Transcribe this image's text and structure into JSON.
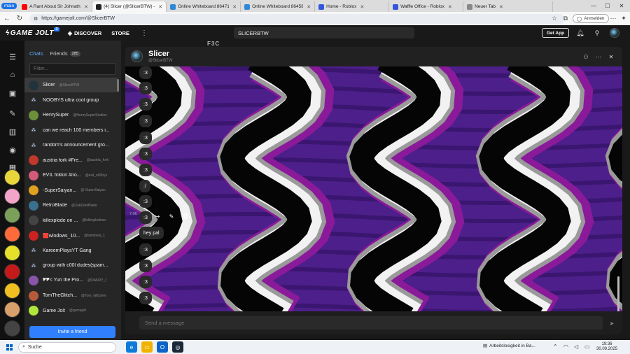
{
  "browser": {
    "tab_group": "main",
    "tabs": [
      {
        "title": "A Rant About Sir Johnatha",
        "color": "#ff0000"
      },
      {
        "title": "(4) Slicer (@SlicerBTW) - Game",
        "color": "#222222",
        "active": true
      },
      {
        "title": "Online Whiteboard 8647151",
        "color": "#2f88d6"
      },
      {
        "title": "Online Whiteboard 8645834",
        "color": "#2f88d6"
      },
      {
        "title": "Home - Roblox",
        "color": "#3355dd"
      },
      {
        "title": "Waffle Office - Roblox",
        "color": "#3355dd"
      },
      {
        "title": "Neuer Tab",
        "color": "#888888"
      }
    ],
    "url": "https://gamejolt.com/@SlicerBTW",
    "signin_label": "Anmelden"
  },
  "gj_nav": {
    "logo": "GAME JOLT",
    "logo_badge": "3",
    "discover": "DISCOVER",
    "store": "STORE",
    "search_value": "SLICERBTW",
    "get_app": "Get App"
  },
  "background_peek": "F3C",
  "sidebar": {
    "tab_chats": "Chats",
    "tab_friends": "Friends",
    "friends_count": "285",
    "filter_placeholder": "Filter...",
    "invite_label": "Invite a friend",
    "chats": [
      {
        "name": "Slicer",
        "user": "@SlicerBTW",
        "type": "user",
        "color": "#21333d",
        "selected": true
      },
      {
        "name": "NOOBYS ultra cool group",
        "user": "",
        "type": "group"
      },
      {
        "name": "HenrySuper",
        "user": "@HenrySuperStudios",
        "type": "user",
        "color": "#6b8f3a"
      },
      {
        "name": "can we reach 100 members i...",
        "user": "",
        "type": "group"
      },
      {
        "name": "random's announcement gro...",
        "user": "",
        "type": "group"
      },
      {
        "name": "austria fork #Fre...",
        "user": "@austria_fork",
        "type": "user",
        "color": "#c0392b"
      },
      {
        "name": "EVIL frikkin #no...",
        "user": "@evil_n00bys",
        "type": "user",
        "color": "#d35b7a"
      },
      {
        "name": "-SuperSaiyan...",
        "user": "@-SuperSaiyan",
        "type": "user",
        "color": "#e0a020"
      },
      {
        "name": "RetroBlade",
        "user": "@ZakDarkBlade",
        "type": "user",
        "color": "#3a6f8f"
      },
      {
        "name": "killexplode on ...",
        "user": "@killexplodeon",
        "type": "user",
        "color": "#444444"
      },
      {
        "name": "🟥windows_10...",
        "user": "@windows_1",
        "type": "user",
        "color": "#cc2222"
      },
      {
        "name": "KareemPlaysYT Gang",
        "user": "",
        "type": "group"
      },
      {
        "name": "group with c00l dudes(spam...",
        "user": "",
        "type": "group"
      },
      {
        "name": "🎔🎔< Yuri the Pro...",
        "user": "@DANDY_I",
        "type": "user",
        "color": "#8855aa"
      },
      {
        "name": "TomTheGlitch...",
        "user": "@Tom_Glitchen",
        "type": "user",
        "color": "#b55a3a"
      },
      {
        "name": "Game Jolt",
        "user": "@gamejolt",
        "type": "user",
        "color": "#b0e63c"
      }
    ]
  },
  "chat": {
    "name": "Slicer",
    "user": "@SlicerBTW",
    "messages": [
      ":3",
      ":3",
      ":3",
      ":3",
      ":3",
      ":3",
      ":3",
      ":/",
      ":3",
      ":3",
      "hey pal",
      ":3",
      ":3",
      ":3",
      ":3"
    ],
    "hover_time": "7:06",
    "composer_placeholder": "Send a message",
    "bg_colors": {
      "purple": "#4d1f8a",
      "dark_purple": "#3a1670",
      "black": "#050505",
      "white": "#f2f2f2",
      "grey": "#9a9a9a",
      "magenta": "#8a1a9a"
    }
  },
  "taskbar": {
    "search_placeholder": "Suche",
    "notification": "Arbeitslosigkeit in Ba...",
    "time": "19:36",
    "date": "30.09.2025"
  }
}
